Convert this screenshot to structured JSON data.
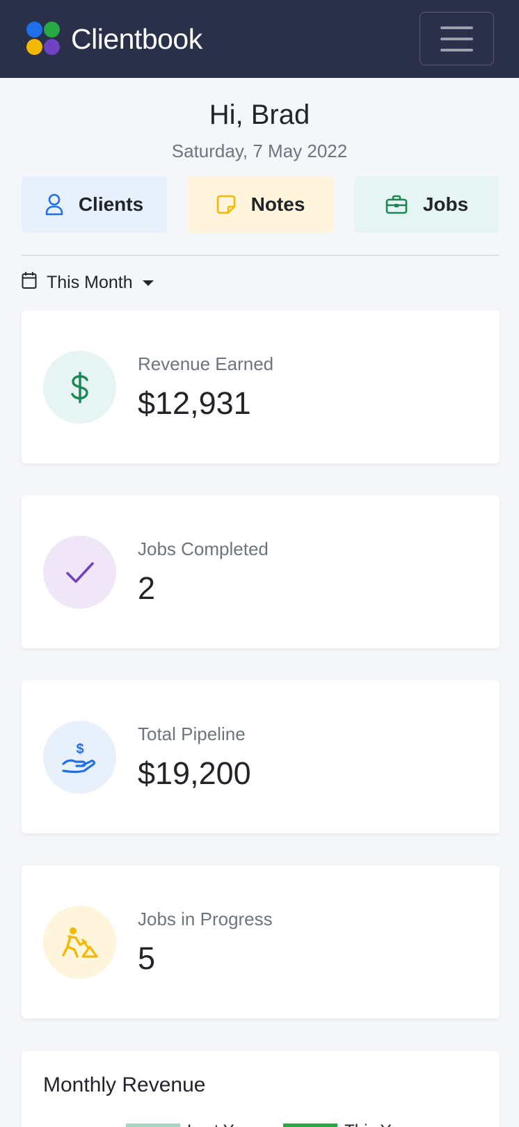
{
  "app": {
    "name": "Clientbook"
  },
  "greeting": {
    "title": "Hi, Brad",
    "date": "Saturday, 7 May 2022"
  },
  "quick_actions": [
    {
      "label": "Clients",
      "icon": "person-icon",
      "bg": "#e8f0fb",
      "icon_color": "#1f6feb"
    },
    {
      "label": "Notes",
      "icon": "sticky-note-icon",
      "bg": "#fff4dc",
      "icon_color": "#f5b800"
    },
    {
      "label": "Jobs",
      "icon": "briefcase-icon",
      "bg": "#e6f4f3",
      "icon_color": "#198754"
    }
  ],
  "period": {
    "label": "This Month"
  },
  "stats": [
    {
      "label": "Revenue Earned",
      "value": "$12,931",
      "icon": "dollar-icon",
      "circle_bg": "#e6f4f3",
      "icon_color": "#198754"
    },
    {
      "label": "Jobs Completed",
      "value": "2",
      "icon": "check-icon",
      "circle_bg": "#efe6f8",
      "icon_color": "#6f42c1"
    },
    {
      "label": "Total Pipeline",
      "value": "$19,200",
      "icon": "hand-dollar-icon",
      "circle_bg": "#e8f0fb",
      "icon_color": "#1f6feb"
    },
    {
      "label": "Jobs in Progress",
      "value": "5",
      "icon": "worker-digging-icon",
      "circle_bg": "#fff4dc",
      "icon_color": "#f5b800"
    }
  ],
  "monthly_revenue": {
    "title": "Monthly Revenue",
    "legend": [
      {
        "label": "Last Year",
        "color": "#a8d5c2"
      },
      {
        "label": "This Year",
        "color": "#28a745"
      }
    ]
  },
  "colors": {
    "navbar": "#2a2f4a",
    "logo": [
      "#1f6feb",
      "#28a745",
      "#f5b800",
      "#6f42c1"
    ]
  }
}
